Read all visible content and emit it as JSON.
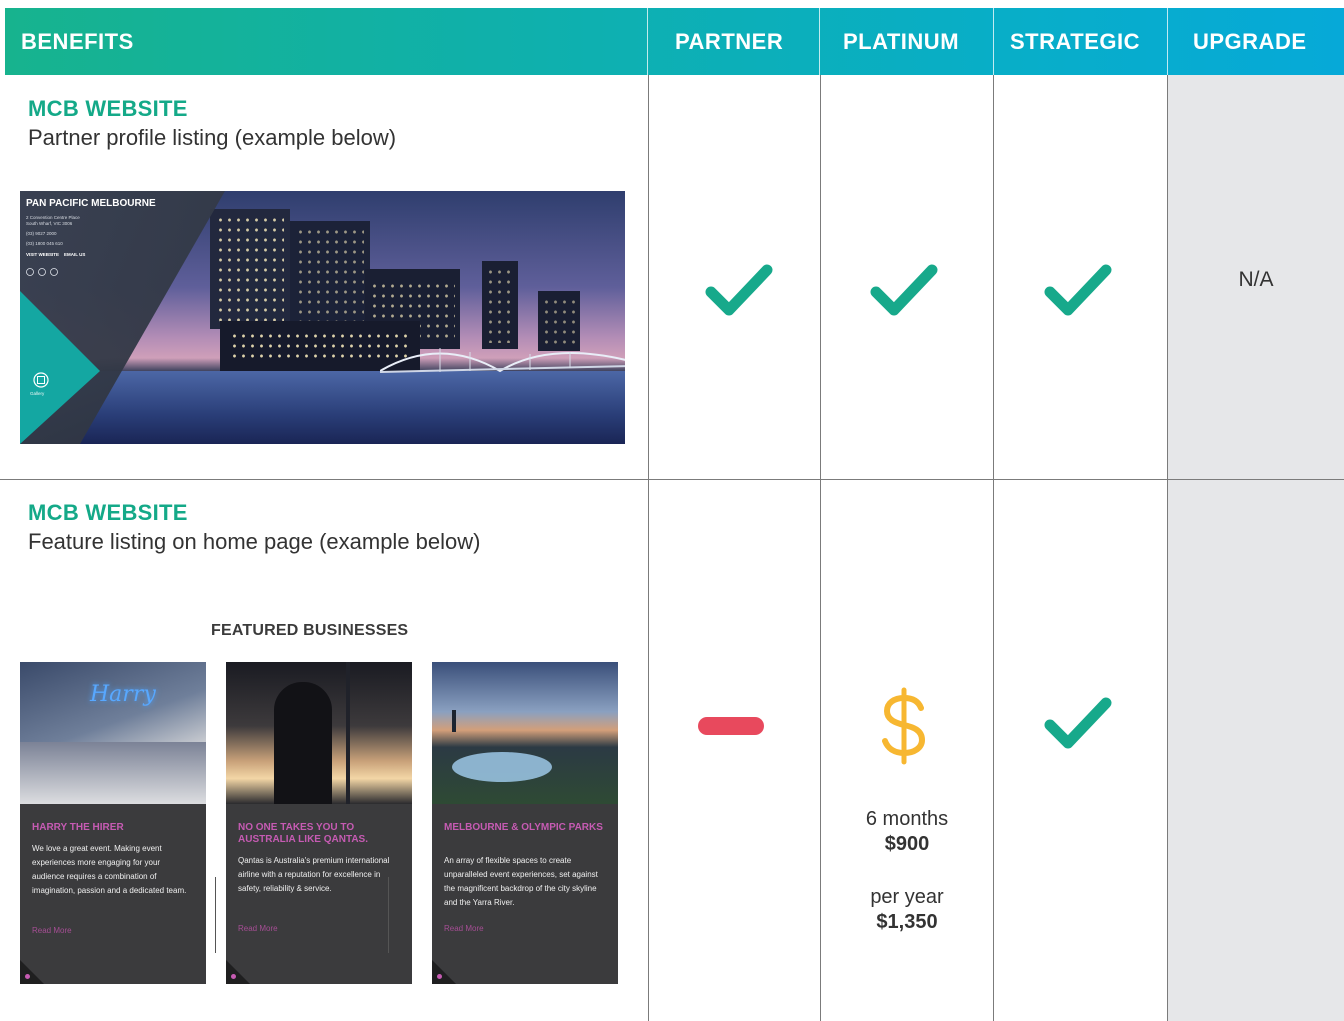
{
  "header": {
    "benefits": "BENEFITS",
    "partner": "PARTNER",
    "platinum": "PLATINUM",
    "strategic": "STRATEGIC",
    "upgrade": "UPGRADE"
  },
  "colors": {
    "header_gradient_start": "#17b38e",
    "header_gradient_end": "#06a9d8",
    "check": "#17a98b",
    "dash": "#e8495d",
    "dollar": "#f7b731",
    "upgrade_column": "#e6e7e9"
  },
  "row1": {
    "title": "MCB WEBSITE",
    "subtitle": "Partner profile listing (example below)",
    "example": {
      "name": "PAN PACIFIC MELBOURNE",
      "address1": "2 Convention Centre Place",
      "address2": "South Wharf, VIC 3006",
      "phone1": "(03) 9027 2000",
      "phone2": "(03) 1800 045 610",
      "links": "VISIT WEBSITE    EMAIL US",
      "gallery": "Gallery"
    },
    "partner": "check-icon",
    "platinum": "check-icon",
    "strategic": "check-icon",
    "upgrade": "N/A"
  },
  "row2": {
    "title": "MCB WEBSITE",
    "subtitle": "Feature listing on home page (example below)",
    "featured_heading": "FEATURED BUSINESSES",
    "cards": [
      {
        "title": "HARRY THE HIRER",
        "body": "We love a great event. Making event experiences more engaging for your audience requires a combination of imagination, passion and a dedicated team.",
        "link": "Read More"
      },
      {
        "title": "NO ONE TAKES YOU TO AUSTRALIA LIKE QANTAS.",
        "body": "Qantas is Australia's premium international airline with a reputation for excellence in safety, reliability & service.",
        "link": "Read More"
      },
      {
        "title": "MELBOURNE & OLYMPIC PARKS",
        "body": "An array of flexible spaces to create unparalleled event experiences, set against the magnificent backdrop of the city skyline and the Yarra River.",
        "link": "Read More"
      }
    ],
    "partner": "dash-icon",
    "platinum": {
      "icon": "dollar-icon",
      "six_months_label": "6 months",
      "six_months_price": "$900",
      "per_year_label": "per year",
      "per_year_price": "$1,350"
    },
    "strategic": "check-icon",
    "upgrade": ""
  }
}
